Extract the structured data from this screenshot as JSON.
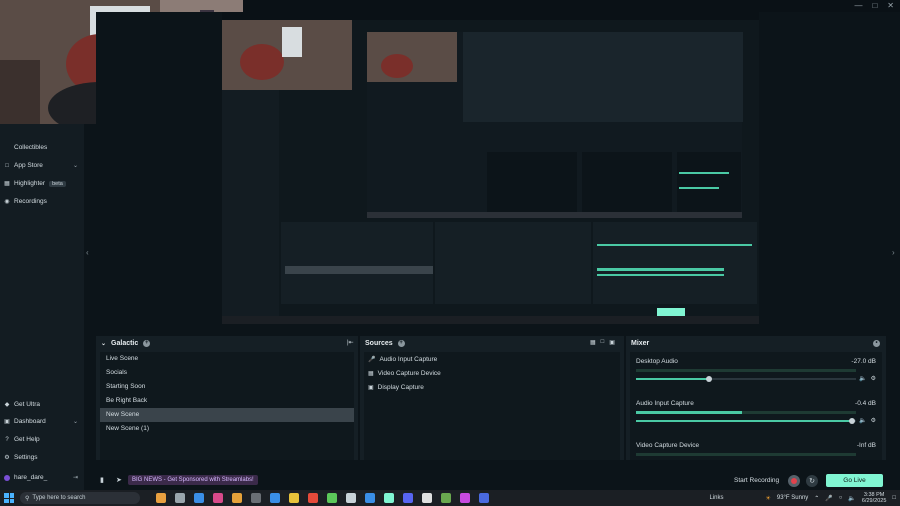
{
  "sidebar": {
    "items_top": [
      {
        "label": "Collectibles",
        "icon": "collectibles-icon"
      },
      {
        "label": "App Store",
        "icon": "app-store-icon"
      },
      {
        "label": "Highlighter",
        "badge": "beta",
        "icon": "highlighter-icon"
      },
      {
        "label": "Recordings",
        "icon": "recordings-icon"
      }
    ],
    "items_bottom": [
      {
        "label": "Get Ultra",
        "icon": "ultra-icon"
      },
      {
        "label": "Dashboard",
        "icon": "dashboard-icon"
      },
      {
        "label": "Get Help",
        "icon": "help-icon"
      },
      {
        "label": "Settings",
        "icon": "settings-icon"
      }
    ],
    "user": "hare_dare_"
  },
  "scenes": {
    "title": "Galactic",
    "items": [
      "Live Scene",
      "Socials",
      "Starting Soon",
      "Be Right Back",
      "New Scene",
      "New Scene (1)"
    ],
    "active": "New Scene"
  },
  "sources": {
    "title": "Sources",
    "items": [
      {
        "label": "Audio Input Capture",
        "icon": "microphone-icon"
      },
      {
        "label": "Video Capture Device",
        "icon": "camera-icon"
      },
      {
        "label": "Display Capture",
        "icon": "monitor-icon"
      }
    ]
  },
  "mixer": {
    "title": "Mixer",
    "channels": [
      {
        "name": "Desktop Audio",
        "db": "-27.0 dB",
        "level": 0.0,
        "volume": 0.33
      },
      {
        "name": "Audio Input Capture",
        "db": "-0.4 dB",
        "level": 0.48,
        "volume": 0.98
      },
      {
        "name": "Video Capture Device",
        "db": "-Inf dB",
        "level": 0.0,
        "volume": 0.0
      }
    ]
  },
  "bottom": {
    "news": "BIG NEWS - Get Sponsored with Streamlabs!",
    "start_recording": "Start Recording",
    "go_live": "Go Live"
  },
  "taskbar": {
    "search_placeholder": "Type here to search",
    "links": "Links",
    "weather": "93°F Sunny",
    "time": "3:38 PM",
    "date": "6/29/2025"
  },
  "colors": {
    "accent": "#80f5d2",
    "meter": "#4ac9a4",
    "news_bg": "#3b2a4a",
    "news_text": "#d6b8ff"
  }
}
